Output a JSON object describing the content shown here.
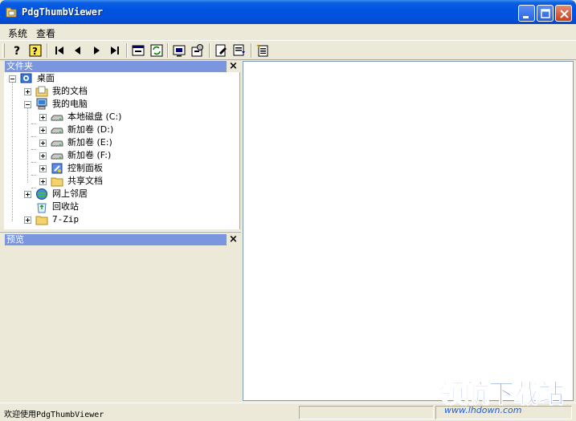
{
  "window": {
    "title": "PdgThumbViewer"
  },
  "menubar": {
    "items": [
      {
        "label": "系统"
      },
      {
        "label": "查看"
      }
    ]
  },
  "toolbar": {
    "buttons": [
      {
        "icon": "help-icon"
      },
      {
        "icon": "about-icon"
      },
      {
        "icon": "first-page-icon"
      },
      {
        "icon": "previous-page-icon"
      },
      {
        "icon": "next-page-icon"
      },
      {
        "icon": "last-page-icon"
      },
      {
        "icon": "window-icon"
      },
      {
        "icon": "refresh-icon"
      },
      {
        "icon": "display-icon"
      },
      {
        "icon": "settings-icon"
      },
      {
        "icon": "edit-icon"
      },
      {
        "icon": "export-icon"
      },
      {
        "icon": "document-icon"
      }
    ]
  },
  "folders_panel": {
    "title": "文件夹",
    "close_symbol": "×",
    "tree": [
      {
        "label": "桌面",
        "icon": "desktop-icon"
      },
      {
        "label": "我的文档",
        "icon": "documents-folder-icon"
      },
      {
        "label": "我的电脑",
        "icon": "computer-icon"
      },
      {
        "label": "本地磁盘 (C:)",
        "icon": "drive-icon"
      },
      {
        "label": "新加卷 (D:)",
        "icon": "drive-icon"
      },
      {
        "label": "新加卷 (E:)",
        "icon": "drive-icon"
      },
      {
        "label": "新加卷 (F:)",
        "icon": "drive-icon"
      },
      {
        "label": "控制面板",
        "icon": "control-panel-icon"
      },
      {
        "label": "共享文档",
        "icon": "folder-icon"
      },
      {
        "label": "网上邻居",
        "icon": "network-icon"
      },
      {
        "label": "回收站",
        "icon": "recycle-bin-icon"
      },
      {
        "label": "7-Zip",
        "icon": "folder-icon"
      }
    ]
  },
  "preview_panel": {
    "title": "预览",
    "close_symbol": "×"
  },
  "statusbar": {
    "message": "欢迎使用PdgThumbViewer"
  },
  "watermark": {
    "brand": "领航下载站",
    "url": "www.lhdown.com"
  },
  "colors": {
    "titlebar": "#0054e3",
    "panel_header": "#7a96df",
    "watermark": "#1f5bd6"
  }
}
